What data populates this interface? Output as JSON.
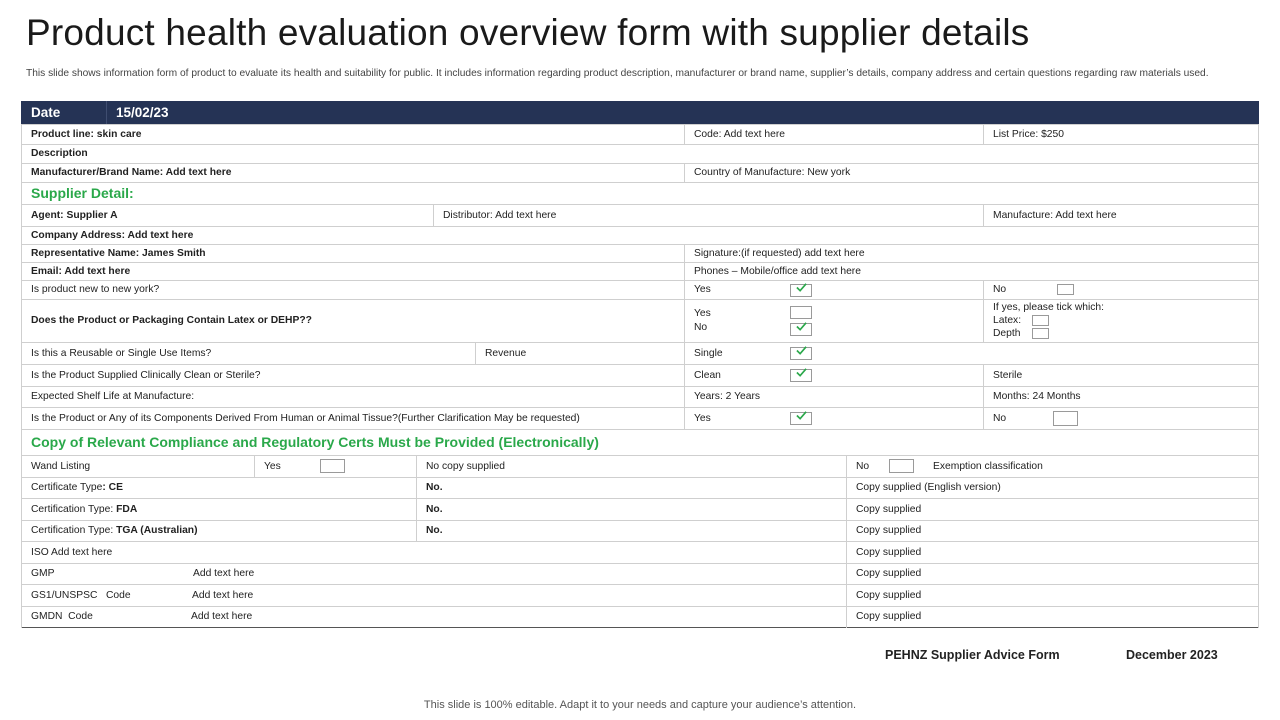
{
  "page": {
    "title": "Product health evaluation overview form with supplier details",
    "description": "This slide shows information form of product to evaluate its health and suitability for public. It includes information regarding product description, manufacturer or brand name, supplier’s details, company address and certain questions regarding raw materials used."
  },
  "form": {
    "date_label": "Date",
    "date_value": "15/02/23",
    "product_line": "Product line: skin care",
    "code": "Code:  Add text here",
    "list_price": "List Price: $250",
    "description_label": "Description",
    "manufacturer_brand": "Manufacturer/Brand Name: Add text here",
    "country_of_manufacture": "Country of Manufacture: New york",
    "supplier_heading": "Supplier Detail:",
    "agent": "Agent: Supplier A",
    "distributor": "Distributor: Add text here",
    "manufacture": "Manufacture: Add text here",
    "company_address": "Company Address: Add text here",
    "representative": "Representative Name: James Smith",
    "signature": "Signature:(if requested) add text here",
    "email": "Email: Add text here",
    "phones": "Phones – Mobile/office add text here",
    "q_new_ny": "Is product new to new york?",
    "yes": "Yes",
    "no": "No",
    "q_latex": "Does the Product or Packaging Contain Latex or DEHP??",
    "if_yes_tick": "If yes, please tick which:",
    "latex": "Latex:",
    "depth": "Depth",
    "q_reusable": "Is this a Reusable or Single Use Items?",
    "revenue": "Revenue",
    "single": "Single",
    "q_clean": "Is the Product Supplied Clinically Clean or Sterile?",
    "clean": "Clean",
    "sterile": "Sterile",
    "q_shelf": "Expected Shelf Life at Manufacture:",
    "years": "Years: 2 Years",
    "months": "Months: 24 Months",
    "q_tissue": "Is the Product or Any of its Components Derived From Human  or Animal Tissue?(Further Clarification May be requested)",
    "compliance_heading": "Copy of Relevant Compliance and Regulatory Certs Must be Provided (Electronically)",
    "wand_listing": "Wand Listing",
    "no_copy_supplied": "No copy supplied",
    "exemption": "Exemption  classification",
    "cert_type_label": "Certificate Type",
    "cert_type_value": ": CE",
    "certification_type_label": "Certification Type: ",
    "fda": "FDA",
    "tga": "TGA (Australian)",
    "no_dot": "No.",
    "copy_supplied_english": "Copy supplied (English version)",
    "copy_supplied": "Copy supplied",
    "iso": "ISO  Add text here",
    "gmp": "GMP",
    "gs1": "GS1/UNSPSC   Code",
    "gmdn": "GMDN  Code",
    "add_text_here": "Add text here"
  },
  "footer": {
    "form_name": "PEHNZ Supplier Advice Form",
    "date": "December  2023",
    "note": "This slide is 100% editable. Adapt it to your needs and capture your audience’s attention."
  },
  "colors": {
    "header_bar": "#253355",
    "section_heading": "#2aa84a",
    "check": "#2aa84a"
  },
  "checkboxes": {
    "new_ny_yes": true,
    "new_ny_no": false,
    "latex_yes": false,
    "latex_no": true,
    "latex_tick": false,
    "depth_tick": false,
    "single": true,
    "clean": true,
    "tissue_yes": true,
    "tissue_no": false,
    "wand_yes": false,
    "wand_no": false
  }
}
